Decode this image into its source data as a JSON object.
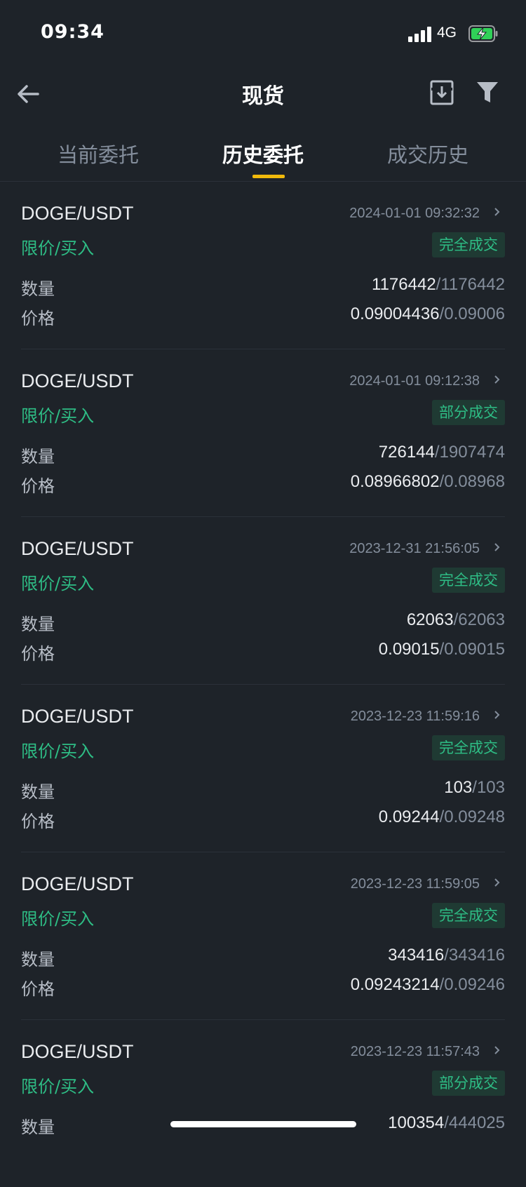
{
  "status_bar": {
    "time": "09:34",
    "network": "4G"
  },
  "nav": {
    "title": "现货",
    "back_icon": "arrow-left-icon",
    "export_icon": "export-icon",
    "filter_icon": "filter-icon"
  },
  "tabs": [
    {
      "label": "当前委托",
      "active": false
    },
    {
      "label": "历史委托",
      "active": true
    },
    {
      "label": "成交历史",
      "active": false
    }
  ],
  "labels": {
    "quantity": "数量",
    "price": "价格",
    "separator": "/"
  },
  "colors": {
    "background": "#1e2329",
    "accent": "#f0b90b",
    "buy_green": "#2ebd85",
    "muted_text": "#848e9c"
  },
  "orders": [
    {
      "pair": "DOGE/USDT",
      "time": "2024-01-01 09:32:32",
      "side": "限价/买入",
      "status": "完全成交",
      "qty_filled": "1176442",
      "qty_total": "1176442",
      "price_avg": "0.09004436",
      "price_order": "0.09006"
    },
    {
      "pair": "DOGE/USDT",
      "time": "2024-01-01 09:12:38",
      "side": "限价/买入",
      "status": "部分成交",
      "qty_filled": "726144",
      "qty_total": "1907474",
      "price_avg": "0.08966802",
      "price_order": "0.08968"
    },
    {
      "pair": "DOGE/USDT",
      "time": "2023-12-31 21:56:05",
      "side": "限价/买入",
      "status": "完全成交",
      "qty_filled": "62063",
      "qty_total": "62063",
      "price_avg": "0.09015",
      "price_order": "0.09015"
    },
    {
      "pair": "DOGE/USDT",
      "time": "2023-12-23 11:59:16",
      "side": "限价/买入",
      "status": "完全成交",
      "qty_filled": "103",
      "qty_total": "103",
      "price_avg": "0.09244",
      "price_order": "0.09248"
    },
    {
      "pair": "DOGE/USDT",
      "time": "2023-12-23 11:59:05",
      "side": "限价/买入",
      "status": "完全成交",
      "qty_filled": "343416",
      "qty_total": "343416",
      "price_avg": "0.09243214",
      "price_order": "0.09246"
    },
    {
      "pair": "DOGE/USDT",
      "time": "2023-12-23 11:57:43",
      "side": "限价/买入",
      "status": "部分成交",
      "qty_filled": "100354",
      "qty_total": "444025",
      "price_avg": "",
      "price_order": ""
    }
  ]
}
